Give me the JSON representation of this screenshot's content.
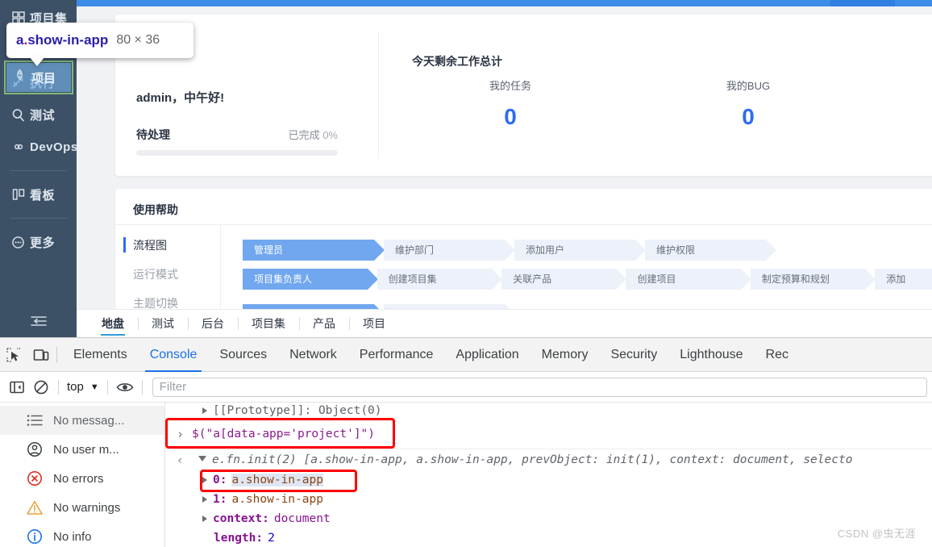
{
  "app": {
    "sidebar": {
      "top_item": {
        "label": "项目集",
        "icon": "grid-icon"
      },
      "items": [
        {
          "label": "项目",
          "icon": "rocket-icon",
          "active": true
        },
        {
          "label": "执行",
          "icon": "run-icon",
          "active": false
        },
        {
          "label": "测试",
          "icon": "magnifier-icon",
          "active": false
        },
        {
          "label": "DevOps",
          "icon": "infinity-icon",
          "active": false
        },
        {
          "label": "看板",
          "icon": "board-icon",
          "active": false
        },
        {
          "label": "更多",
          "icon": "more-circle-icon",
          "active": false
        }
      ],
      "collapse_icon": "collapse-menu-icon"
    },
    "overview_card": {
      "greeting": "admin，中午好!",
      "pending_label": "待处理",
      "completed_label": "已完成",
      "completed_value": "0%",
      "stats_title": "今天剩余工作总计",
      "stats": [
        {
          "label": "我的任务",
          "value": "0"
        },
        {
          "label": "我的BUG",
          "value": "0"
        }
      ]
    },
    "help_card": {
      "title": "使用帮助",
      "menu": [
        {
          "label": "流程图",
          "active": true
        },
        {
          "label": "运行模式",
          "active": false
        },
        {
          "label": "主题切换",
          "active": false
        }
      ],
      "flows": [
        {
          "role": "管理员",
          "steps": [
            "维护部门",
            "添加用户",
            "维护权限"
          ]
        },
        {
          "role": "项目集负责人",
          "steps": [
            "创建项目集",
            "关联产品",
            "创建项目",
            "制定预算和规划",
            "添加"
          ]
        }
      ]
    },
    "tabs": [
      {
        "label": "地盘",
        "active": true
      },
      {
        "label": "测试",
        "active": false
      },
      {
        "label": "后台",
        "active": false
      },
      {
        "label": "项目集",
        "active": false
      },
      {
        "label": "产品",
        "active": false
      },
      {
        "label": "项目",
        "active": false
      }
    ]
  },
  "inspector": {
    "tooltip": {
      "tag_prefix": "a",
      "tag_dot": ".",
      "tag_class": "show-in-app",
      "dimensions": "80 × 36"
    },
    "highlight_label": "项目"
  },
  "devtools": {
    "left_icons": [
      {
        "name": "inspect-element-icon"
      },
      {
        "name": "device-toolbar-icon"
      }
    ],
    "tabs": [
      {
        "label": "Elements",
        "active": false
      },
      {
        "label": "Console",
        "active": true
      },
      {
        "label": "Sources",
        "active": false
      },
      {
        "label": "Network",
        "active": false
      },
      {
        "label": "Performance",
        "active": false
      },
      {
        "label": "Application",
        "active": false
      },
      {
        "label": "Memory",
        "active": false
      },
      {
        "label": "Security",
        "active": false
      },
      {
        "label": "Lighthouse",
        "active": false
      },
      {
        "label": "Rec",
        "active": false
      }
    ],
    "toolbar": {
      "sidebar_toggle_icon": "console-sidebar-icon",
      "clear_icon": "clear-console-icon",
      "context_value": "top",
      "context_caret": "▼",
      "eye_icon": "live-expression-eye-icon",
      "filter_placeholder": "Filter"
    },
    "sidebar": [
      {
        "label": "No messag...",
        "icon": "list-icon",
        "selected": true
      },
      {
        "label": "No user m...",
        "icon": "user-icon",
        "selected": false
      },
      {
        "label": "No errors",
        "icon": "error-icon",
        "selected": false
      },
      {
        "label": "No warnings",
        "icon": "warning-icon",
        "selected": false
      },
      {
        "label": "No info",
        "icon": "info-icon",
        "selected": false
      }
    ],
    "console": {
      "scrollback_line": "[[Prototype]]: Object(0)",
      "prompt_chevron": "›",
      "input_expression": "$(\"a[data-app='project']\")",
      "result_chevron": "‹",
      "result_summary": "e.fn.init(2) [a.show-in-app, a.show-in-app, prevObject: init(1), context: document, selecto",
      "properties": [
        {
          "key": "0",
          "value": "a.show-in-app",
          "highlighted": true,
          "expandable": true
        },
        {
          "key": "1",
          "value": "a.show-in-app",
          "highlighted": false,
          "expandable": true
        },
        {
          "key": "context",
          "value": "document",
          "highlighted": false,
          "expandable": true
        },
        {
          "key": "length",
          "value": "2",
          "highlighted": false,
          "expandable": false
        }
      ]
    }
  },
  "watermark": "CSDN @虫无涯",
  "colors": {
    "accent_blue": "#2f6bf2",
    "devtools_active": "#1a73e8",
    "annotation_red": "#ff0000",
    "sidebar_bg": "#3d5166",
    "chip_primary": "#71a7ee",
    "chip_muted": "#edf1f9"
  }
}
